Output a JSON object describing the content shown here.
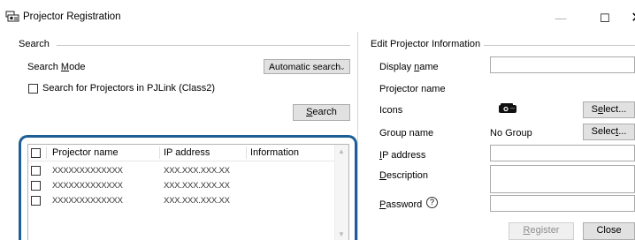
{
  "window": {
    "title": "Projector Registration",
    "min_glyph": "—",
    "max_glyph": "☐",
    "close_glyph": "✕"
  },
  "search": {
    "group_title": "Search",
    "mode_label_pre": "Search ",
    "mode_label_u": "M",
    "mode_label_post": "ode",
    "mode_value": "Automatic search",
    "pjlink_pre": "Search for Pro",
    "pjlink_u": "j",
    "pjlink_post": "ectors in PJLink (Class2)",
    "pjlink_checked": false,
    "search_button_u": "S",
    "search_button_post": "earch"
  },
  "list": {
    "columns": [
      "Projector name",
      "IP address",
      "Information"
    ],
    "rows": [
      {
        "name": "XXXXXXXXXXXXX",
        "ip": "XXX.XXX.XXX.XX",
        "info": ""
      },
      {
        "name": "XXXXXXXXXXXXX",
        "ip": "XXX.XXX.XXX.XX",
        "info": ""
      },
      {
        "name": "XXXXXXXXXXXXX",
        "ip": "XXX.XXX.XXX.XX",
        "info": ""
      }
    ]
  },
  "edit": {
    "group_title": "Edit Projector Information",
    "display_name_pre": "Display ",
    "display_name_u": "n",
    "display_name_post": "ame",
    "display_name_value": "",
    "projector_name_label": "Projector name",
    "icons_label": "Icons",
    "icons_select_pre": "S",
    "icons_select_u": "e",
    "icons_select_post": "lect...",
    "group_name_label": "Group name",
    "group_name_value": "No Group",
    "group_select_pre": "Selec",
    "group_select_u": "t",
    "group_select_post": "...",
    "ip_label_u": "I",
    "ip_label_post": "P address",
    "ip_value": "",
    "description_u": "D",
    "description_post": "escription",
    "description_value": "",
    "password_u": "P",
    "password_post": "assword",
    "password_value": "",
    "help_glyph": "?"
  },
  "footer": {
    "register_u": "R",
    "register_post": "egister",
    "close_label": "Close"
  },
  "icons": [
    "app-icon",
    "projector-icon",
    "help-icon",
    "chevron-down-icon"
  ]
}
